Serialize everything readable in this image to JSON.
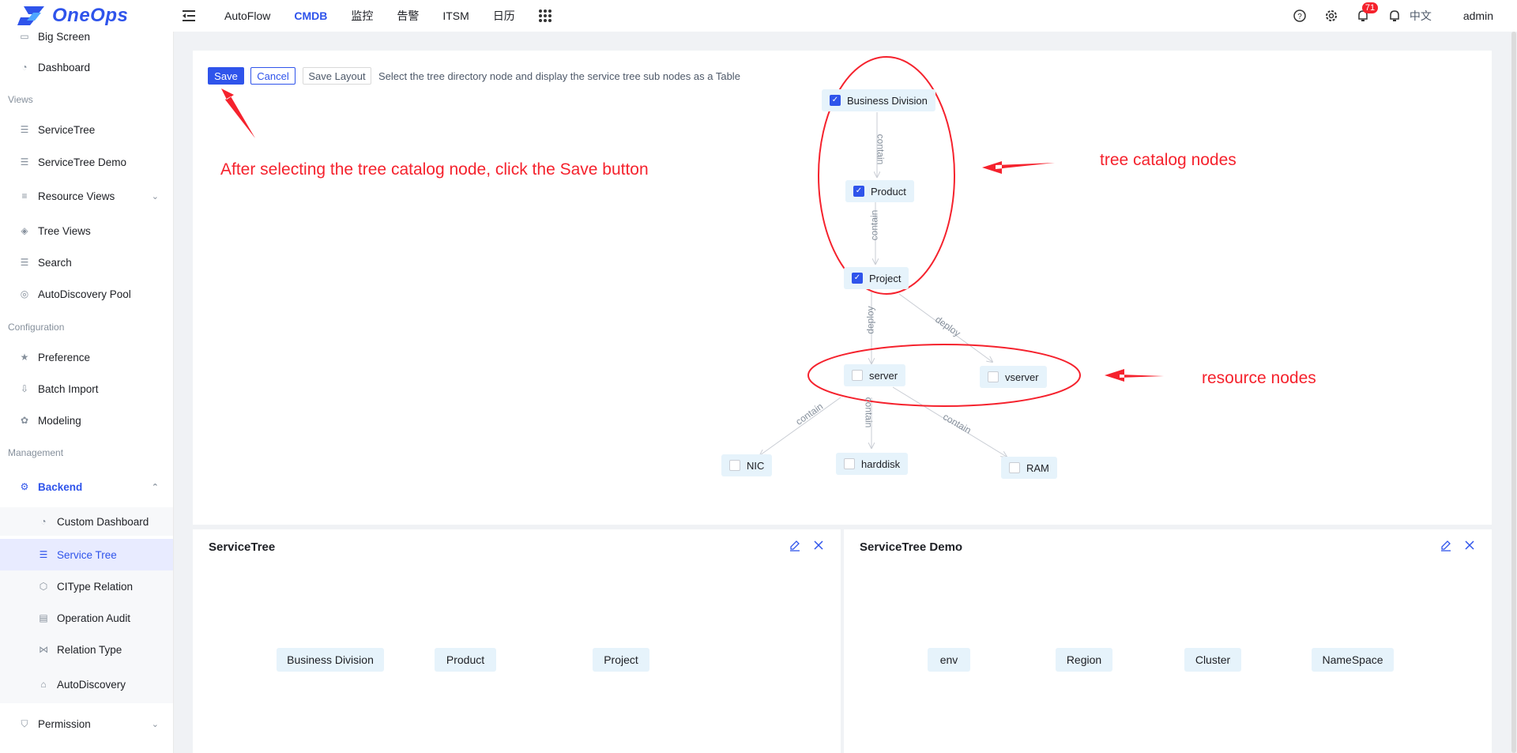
{
  "app": {
    "name": "OneOps"
  },
  "topnav": {
    "items": [
      "AutoFlow",
      "CMDB",
      "监控",
      "告警",
      "ITSM",
      "日历"
    ],
    "notifications_count": "71",
    "language": "中文",
    "user": "admin"
  },
  "sidebar": {
    "items": {
      "big_screen": "Big Screen",
      "dashboard": "Dashboard",
      "views_section": "Views",
      "service_tree": "ServiceTree",
      "service_tree_demo": "ServiceTree Demo",
      "resource_views": "Resource Views",
      "tree_views": "Tree Views",
      "search": "Search",
      "autodiscovery_pool": "AutoDiscovery Pool",
      "configuration_section": "Configuration",
      "preference": "Preference",
      "batch_import": "Batch Import",
      "modeling": "Modeling",
      "management_section": "Management",
      "backend": "Backend",
      "custom_dashboard": "Custom Dashboard",
      "service_tree_sub": "Service Tree",
      "citype_relation": "CIType Relation",
      "operation_audit": "Operation Audit",
      "relation_type": "Relation Type",
      "autodiscovery": "AutoDiscovery",
      "permission": "Permission"
    }
  },
  "toolbar": {
    "save": "Save",
    "cancel": "Cancel",
    "save_layout": "Save Layout",
    "hint": "Select the tree directory node and display the service tree sub nodes as a Table"
  },
  "graph": {
    "nodes": {
      "business_division": {
        "label": "Business Division",
        "checked": true
      },
      "product": {
        "label": "Product",
        "checked": true
      },
      "project": {
        "label": "Project",
        "checked": true
      },
      "server": {
        "label": "server",
        "checked": false
      },
      "vserver": {
        "label": "vserver",
        "checked": false
      },
      "nic": {
        "label": "NIC",
        "checked": false
      },
      "harddisk": {
        "label": "harddisk",
        "checked": false
      },
      "ram": {
        "label": "RAM",
        "checked": false
      }
    },
    "edges": {
      "bd_product": "contain",
      "product_project": "contain",
      "project_server": "deploy",
      "project_vserver": "deploy",
      "server_nic": "contain",
      "server_harddisk": "contain",
      "server_ram": "contain"
    }
  },
  "annotations": {
    "save_hint": "After selecting the tree catalog node, click the Save button",
    "tree_catalog": "tree catalog nodes",
    "resource_nodes": "resource nodes",
    "color": "#f5222d"
  },
  "panels": {
    "left": {
      "title": "ServiceTree",
      "flow": [
        "Business Division",
        "Product",
        "Project"
      ]
    },
    "right": {
      "title": "ServiceTree Demo",
      "flow": [
        "env",
        "Region",
        "Cluster",
        "NameSpace"
      ]
    }
  },
  "colors": {
    "accent": "#2f54eb",
    "node_bg": "#e6f3fb"
  }
}
